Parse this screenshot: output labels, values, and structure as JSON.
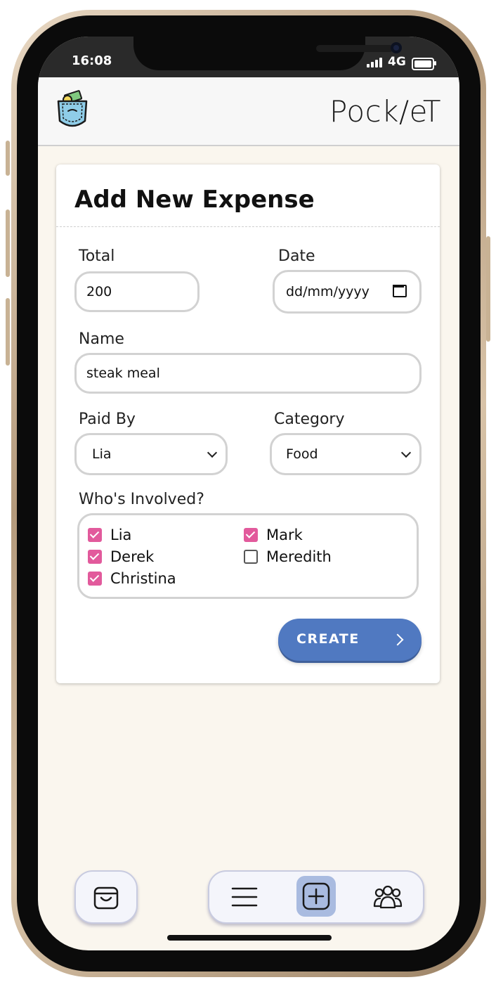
{
  "status_bar": {
    "time": "16:08",
    "network": "4G"
  },
  "app": {
    "title": "Pock/eT",
    "logo_icon": "pocket-money-icon"
  },
  "form": {
    "title": "Add New Expense",
    "total": {
      "label": "Total",
      "value": "200"
    },
    "date": {
      "label": "Date",
      "placeholder": "dd/mm/yyyy"
    },
    "name": {
      "label": "Name",
      "value": "steak meal"
    },
    "paid_by": {
      "label": "Paid By",
      "selected": "Lia"
    },
    "category": {
      "label": "Category",
      "selected": "Food"
    },
    "involved": {
      "label": "Who's Involved?",
      "people": [
        {
          "name": "Lia",
          "checked": true
        },
        {
          "name": "Mark",
          "checked": true
        },
        {
          "name": "Derek",
          "checked": true
        },
        {
          "name": "Meredith",
          "checked": false
        },
        {
          "name": "Christina",
          "checked": true
        }
      ]
    },
    "create_label": "CREATE"
  },
  "bottom_nav": {
    "icons": [
      "shopping-bag-icon",
      "menu-icon",
      "add-icon",
      "group-icon"
    ],
    "active": "add-icon"
  },
  "colors": {
    "accent": "#5079c1",
    "checkbox": "#e25a9c",
    "nav_active": "#a9bbe0",
    "background": "#faf6ee"
  }
}
